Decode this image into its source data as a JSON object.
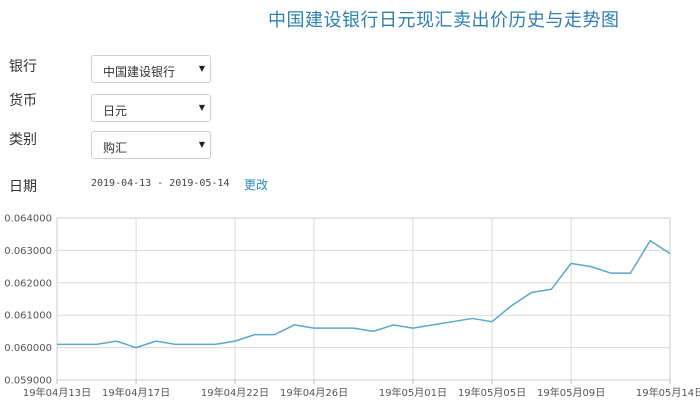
{
  "page": {
    "title": "中国建设银行日元现汇卖出价历史与走势图"
  },
  "form": {
    "bank": {
      "label": "银行",
      "value": "中国建设银行"
    },
    "currency": {
      "label": "货币",
      "value": "日元"
    },
    "category": {
      "label": "类别",
      "value": "购汇"
    },
    "date": {
      "label": "日期",
      "range": "2019-04-13 - 2019-05-14",
      "change_label": "更改"
    }
  },
  "icons": {
    "dropdown": "chevron-down-icon"
  },
  "colors": {
    "title": "#2f7fb0",
    "line": "#5ba8c8",
    "grid": "#d9d9d9",
    "link": "#2a8ab9"
  },
  "chart_data": {
    "type": "line",
    "title": "",
    "xlabel": "",
    "ylabel": "",
    "ylim": [
      0.059,
      0.064
    ],
    "y_ticks": [
      "0.059000",
      "0.060000",
      "0.061000",
      "0.062000",
      "0.063000",
      "0.064000"
    ],
    "x_tick_labels": [
      "19年04月13日",
      "19年04月17日",
      "19年04月22日",
      "19年04月26日",
      "19年05月01日",
      "19年05月05日",
      "19年05月09日",
      "19年05月14日"
    ],
    "grid": true,
    "legend": "none",
    "x": [
      "2019-04-13",
      "2019-04-14",
      "2019-04-15",
      "2019-04-16",
      "2019-04-17",
      "2019-04-18",
      "2019-04-19",
      "2019-04-20",
      "2019-04-21",
      "2019-04-22",
      "2019-04-23",
      "2019-04-24",
      "2019-04-25",
      "2019-04-26",
      "2019-04-27",
      "2019-04-28",
      "2019-04-29",
      "2019-04-30",
      "2019-05-01",
      "2019-05-02",
      "2019-05-03",
      "2019-05-04",
      "2019-05-05",
      "2019-05-06",
      "2019-05-07",
      "2019-05-08",
      "2019-05-09",
      "2019-05-10",
      "2019-05-11",
      "2019-05-12",
      "2019-05-13",
      "2019-05-14"
    ],
    "values": [
      0.0601,
      0.0601,
      0.0601,
      0.0602,
      0.06,
      0.0602,
      0.0601,
      0.0601,
      0.0601,
      0.0602,
      0.0604,
      0.0604,
      0.0607,
      0.0606,
      0.0606,
      0.0606,
      0.0605,
      0.0607,
      0.0606,
      0.0607,
      0.0608,
      0.0609,
      0.0608,
      0.0613,
      0.0617,
      0.0618,
      0.0626,
      0.0625,
      0.0623,
      0.0623,
      0.0633,
      0.0629
    ]
  }
}
